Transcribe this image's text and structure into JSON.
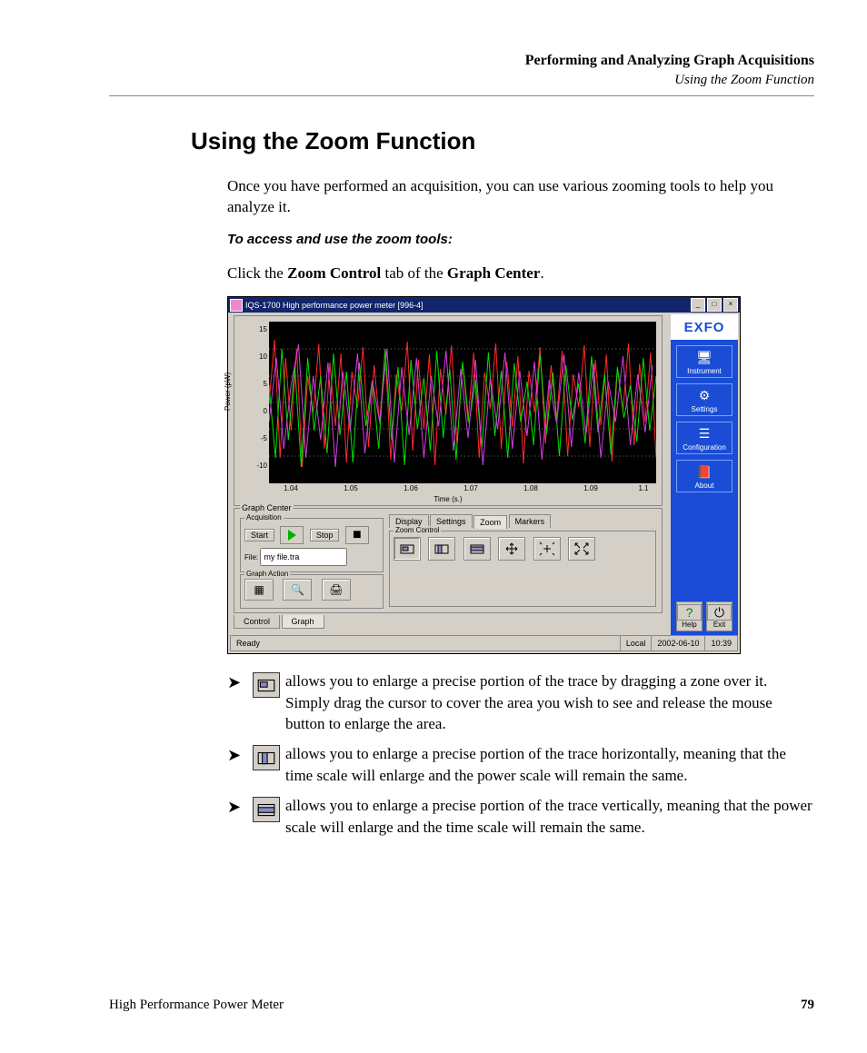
{
  "header": {
    "running_title": "Performing and Analyzing Graph Acquisitions",
    "running_sub": "Using the Zoom Function"
  },
  "title": "Using the Zoom Function",
  "intro": "Once you have performed an acquisition, you can use various zooming tools to help you analyze it.",
  "subhead": "To access and use the zoom tools:",
  "instruction_pre": "Click the ",
  "instruction_b1": "Zoom Control",
  "instruction_mid": " tab of the ",
  "instruction_b2": "Graph Center",
  "instruction_post": ".",
  "screenshot": {
    "window_title": "IQS-1700 High performance power meter [996-4]",
    "chart": {
      "ylabel": "Power (pW)",
      "xlabel": "Time (s.)",
      "yticks": [
        "15",
        "10",
        "5",
        "0",
        "-5",
        "-10"
      ],
      "xticks": [
        "1.04",
        "1.05",
        "1.06",
        "1.07",
        "1.08",
        "1.09",
        "1.1"
      ]
    },
    "graph_center_label": "Graph Center",
    "acquisition": {
      "label": "Acquisition",
      "start": "Start",
      "stop": "Stop",
      "file_label": "File:",
      "file_value": "my file.tra"
    },
    "graph_action_label": "Graph Action",
    "tabs": {
      "display": "Display",
      "settings": "Settings",
      "zoom": "Zoom",
      "markers": "Markers"
    },
    "zoom_control_label": "Zoom Control",
    "bottom_tabs": {
      "control": "Control",
      "graph": "Graph"
    },
    "status": {
      "ready": "Ready",
      "mode": "Local",
      "date": "2002-06-10",
      "time": "10:39"
    },
    "sidebar": {
      "logo": "EXFO",
      "instrument": "Instrument",
      "settings": "Settings",
      "configuration": "Configuration",
      "about": "About",
      "help": "Help",
      "exit": "Exit"
    }
  },
  "bullets": [
    "allows you to enlarge a precise portion of the trace by dragging a zone over it. Simply drag the cursor to cover the area you wish to see and release the mouse button to enlarge the area.",
    "allows you to enlarge a precise portion of the trace horizontally, meaning that the time scale will enlarge and the power scale will remain the same.",
    "allows you to enlarge a precise portion of the trace vertically, meaning that the power scale will enlarge and the time scale will remain the same."
  ],
  "footer": {
    "left": "High Performance Power Meter",
    "page": "79"
  }
}
